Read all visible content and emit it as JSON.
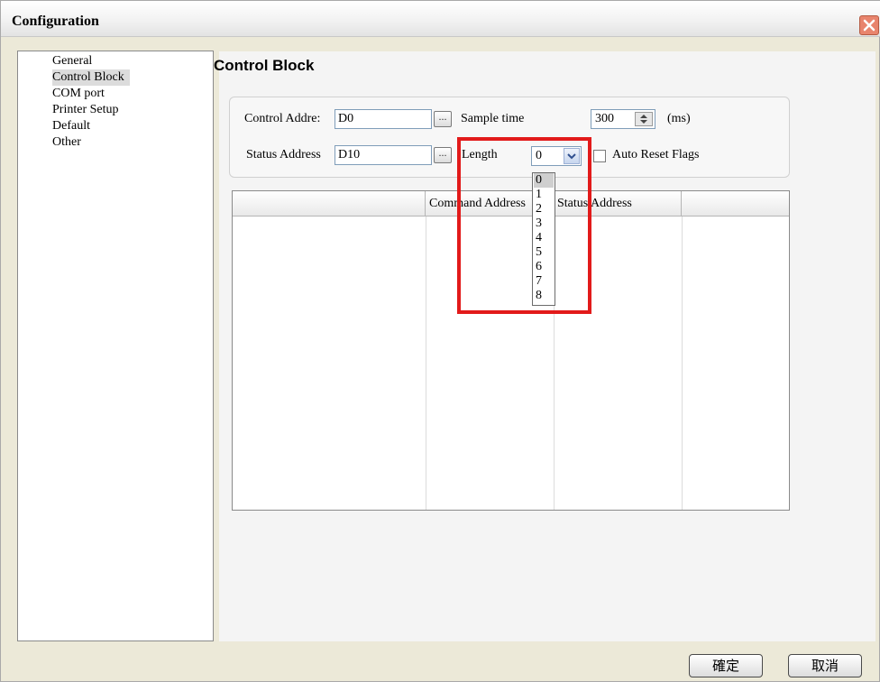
{
  "window": {
    "title": "Configuration"
  },
  "sidebar": {
    "items": [
      {
        "label": "General"
      },
      {
        "label": "Control Block",
        "selected": true
      },
      {
        "label": "COM port"
      },
      {
        "label": "Printer Setup"
      },
      {
        "label": "Default"
      },
      {
        "label": "Other"
      }
    ]
  },
  "section": {
    "title": "Control Block"
  },
  "form": {
    "control_address_label": "Control Addre:",
    "control_address_value": "D0",
    "status_address_label": "Status Address",
    "status_address_value": "D10",
    "browse_glyph": "...",
    "sample_time_label": "Sample time",
    "sample_time_value": "300",
    "sample_time_unit": "(ms)",
    "length_label": "Length",
    "length_value": "0",
    "auto_reset_label": "Auto Reset Flags",
    "auto_reset_checked": false
  },
  "length_dropdown": {
    "options": [
      "0",
      "1",
      "2",
      "3",
      "4",
      "5",
      "6",
      "7",
      "8"
    ],
    "selected": "0"
  },
  "table": {
    "columns": [
      "",
      "Command Address",
      "Status Address",
      ""
    ]
  },
  "footer": {
    "ok_label": "確定",
    "cancel_label": "取消"
  },
  "colors": {
    "highlight": "#e21a1a",
    "titlebar": "#f2f2f2",
    "close_button": "#e8846d"
  }
}
